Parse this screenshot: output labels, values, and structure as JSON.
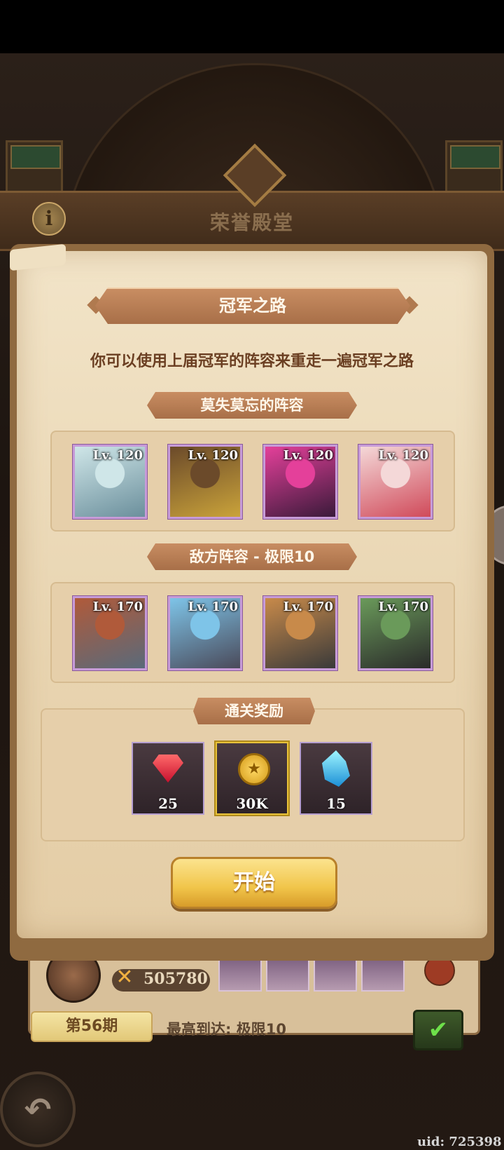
{
  "hall": {
    "title": "荣誉殿堂",
    "info_icon": "i"
  },
  "dialog": {
    "title": "冠军之路",
    "description": "你可以使用上届冠军的阵容来重走一遍冠军之路",
    "team_section": {
      "label": "莫失莫忘的阵容",
      "heroes": [
        {
          "level": "Lv. 120",
          "colors": [
            "#cfe6e8",
            "#6b8f9c"
          ]
        },
        {
          "level": "Lv. 120",
          "colors": [
            "#6b4a2a",
            "#caa33a"
          ]
        },
        {
          "level": "Lv. 120",
          "colors": [
            "#e4409a",
            "#3a1a3a"
          ]
        },
        {
          "level": "Lv. 120",
          "colors": [
            "#f4d8d8",
            "#d04a5a"
          ]
        }
      ]
    },
    "enemy_section": {
      "label": "敌方阵容 - 极限10",
      "heroes": [
        {
          "level": "Lv. 170",
          "colors": [
            "#b05a3a",
            "#5a6a7a"
          ]
        },
        {
          "level": "Lv. 170",
          "colors": [
            "#7ec4e8",
            "#4a4a5a"
          ]
        },
        {
          "level": "Lv. 170",
          "colors": [
            "#c88a4a",
            "#3a3a3a"
          ]
        },
        {
          "level": "Lv. 170",
          "colors": [
            "#6a9a5a",
            "#2a2a2a"
          ]
        }
      ]
    },
    "rewards": {
      "label": "通关奖励",
      "items": [
        {
          "icon": "ruby-icon",
          "count": "25"
        },
        {
          "icon": "gold-coin-icon",
          "count": "30K"
        },
        {
          "icon": "crystal-icon",
          "count": "15"
        }
      ]
    },
    "start_label": "开始"
  },
  "underlay": {
    "power": "505780",
    "season": "第56期",
    "best": "最高到达: 极限10"
  },
  "uid": "uid: 725398",
  "colors": {
    "accent": "#c88d62",
    "button": "#f1c54a",
    "frame_purple": "#c79bd8"
  }
}
